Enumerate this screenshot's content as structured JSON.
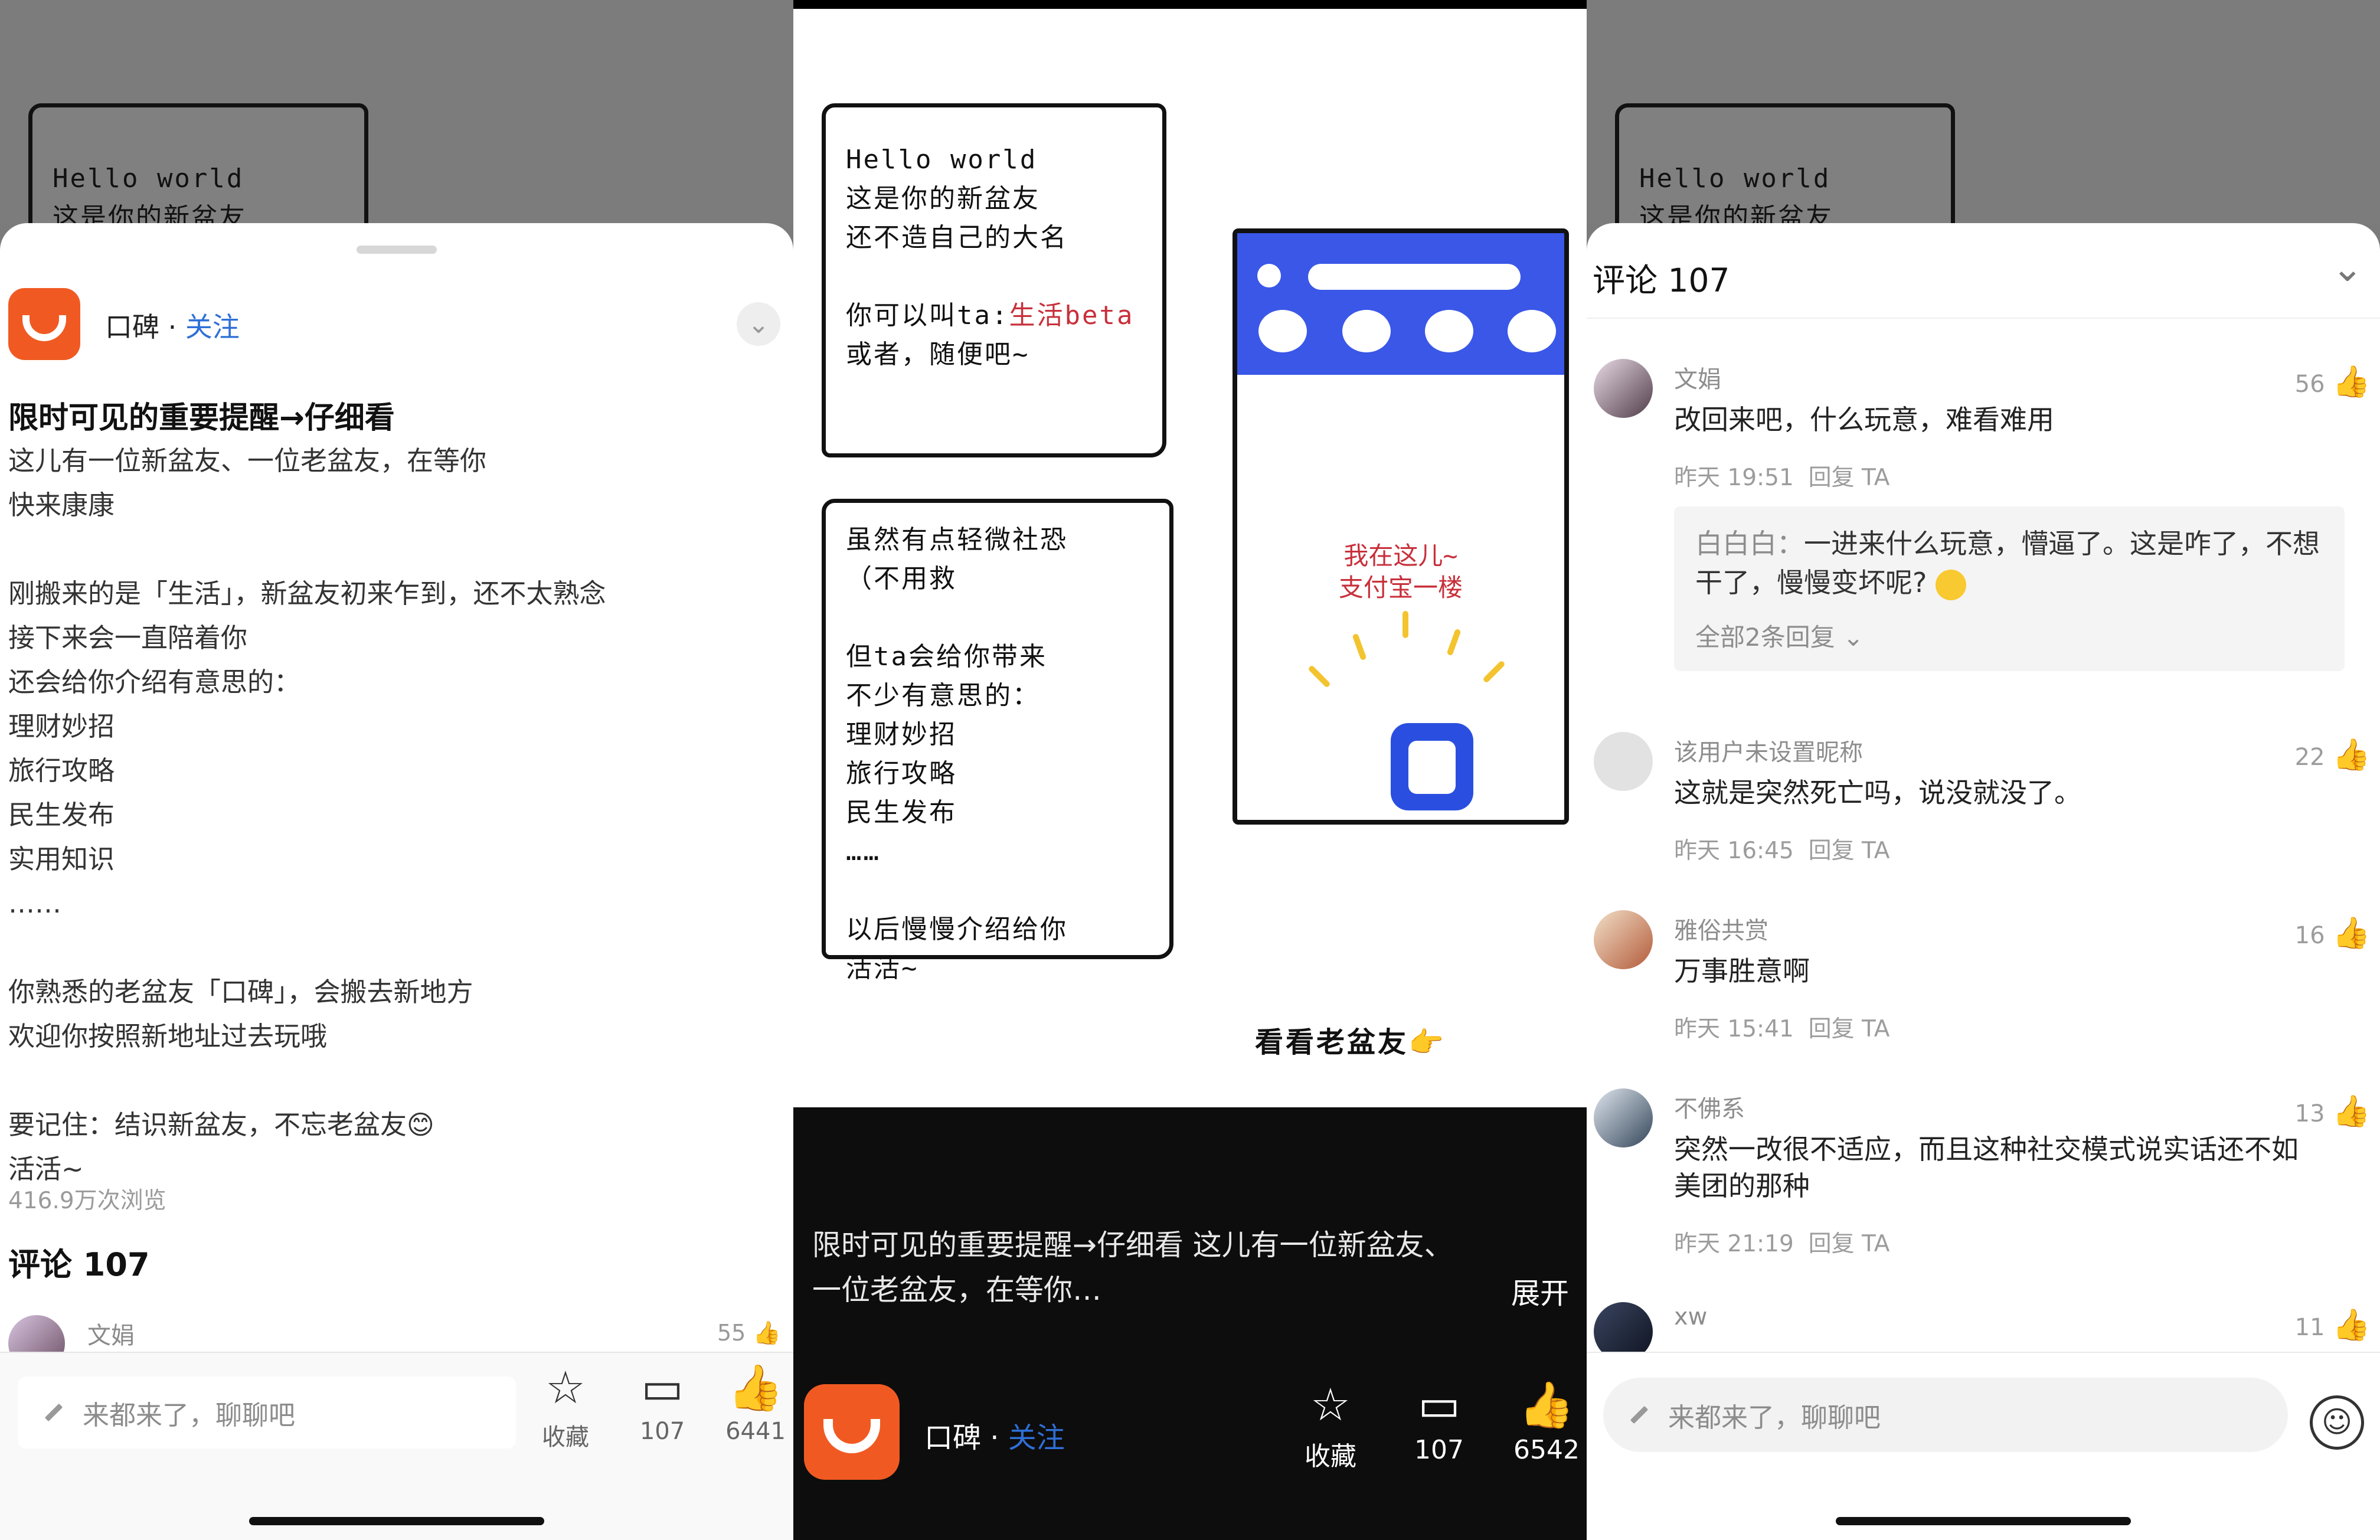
{
  "comic": {
    "bubble1_lines": "Hello world\n这是你的新盆友\n还不造自己的大名\n\n你可以叫ta:",
    "bubble1_red": "生活beta",
    "bubble1_tail": "\n或者，随便吧~",
    "bubble1_peek": "Hello world\n这是你的新盆友",
    "bubble2_text": "虽然有点轻微社恐\n（不用救\n\n但ta会给你带来\n不少有意思的：\n理财妙招\n旅行攻略\n民生发布\n……\n\n以后慢慢介绍给你\n活活~",
    "phone_caption": "我在这儿~\n支付宝一楼",
    "see_old": "看看老盆友👉"
  },
  "post": {
    "author": "口碑",
    "separator": " · ",
    "follow": "关注",
    "chevron": "⌄",
    "title": "限时可见的重要提醒→仔细看",
    "body": "这儿有一位新盆友、一位老盆友，在等你\n快来康康\n\n刚搬来的是「生活」，新盆友初来乍到，还不太熟念\n接下来会一直陪着你\n还会给你介绍有意思的：\n理财妙招\n旅行攻略\n民生发布\n实用知识\n……\n\n你熟悉的老盆友「口碑」，会搬去新地方\n欢迎你按照新地址过去玩哦\n\n要记住：结识新盆友，不忘老盆友😊\n活活~",
    "views": "416.9万次浏览",
    "comments_header": "评论 107",
    "peek_name": "文娟",
    "peek_likes": "55"
  },
  "bar1": {
    "placeholder": "来都来了，聊聊吧",
    "collect_label": "收藏",
    "comment_count": "107",
    "like_count": "6441"
  },
  "video": {
    "caption": "限时可见的重要提醒→仔细看 这儿有一位新盆友、一位老盆友，在等你…",
    "expand": "展开",
    "collect_label": "收藏",
    "comment_count": "107",
    "like_count": "6542"
  },
  "comments_panel": {
    "title": "评论 107",
    "close": "⌄",
    "items": [
      {
        "name": "文娟",
        "likes": "56",
        "text": "改回来吧，什么玩意，难看难用",
        "time": "昨天 19:51",
        "reply_label": "回复 TA",
        "reply_name": "白白白：",
        "reply_text": "一进来什么玩意，懵逼了。这是咋了，不想干了，慢慢变坏呢?",
        "reply_more": "全部2条回复 ⌄"
      },
      {
        "name": "该用户未设置昵称",
        "likes": "22",
        "text": "这就是突然死亡吗，说没就没了。",
        "time": "昨天 16:45",
        "reply_label": "回复 TA"
      },
      {
        "name": "雅俗共赏",
        "likes": "16",
        "text": "万事胜意啊",
        "time": "昨天 15:41",
        "reply_label": "回复 TA"
      },
      {
        "name": "不佛系",
        "likes": "13",
        "text": "突然一改很不适应，而且这种社交模式说实话还不如美团的那种",
        "time": "昨天 21:19",
        "reply_label": "回复 TA"
      },
      {
        "name": "xw",
        "likes": "11"
      }
    ],
    "placeholder": "来都来了，聊聊吧"
  },
  "icons": {
    "star": "☆",
    "comment": "▭",
    "like": "👍",
    "thumb": "👍",
    "smile": "☺"
  },
  "colors": {
    "brand": "#f05a22",
    "link": "#2f6fd7",
    "accent_blue": "#3a57e8",
    "accent_red": "#c8303b"
  }
}
